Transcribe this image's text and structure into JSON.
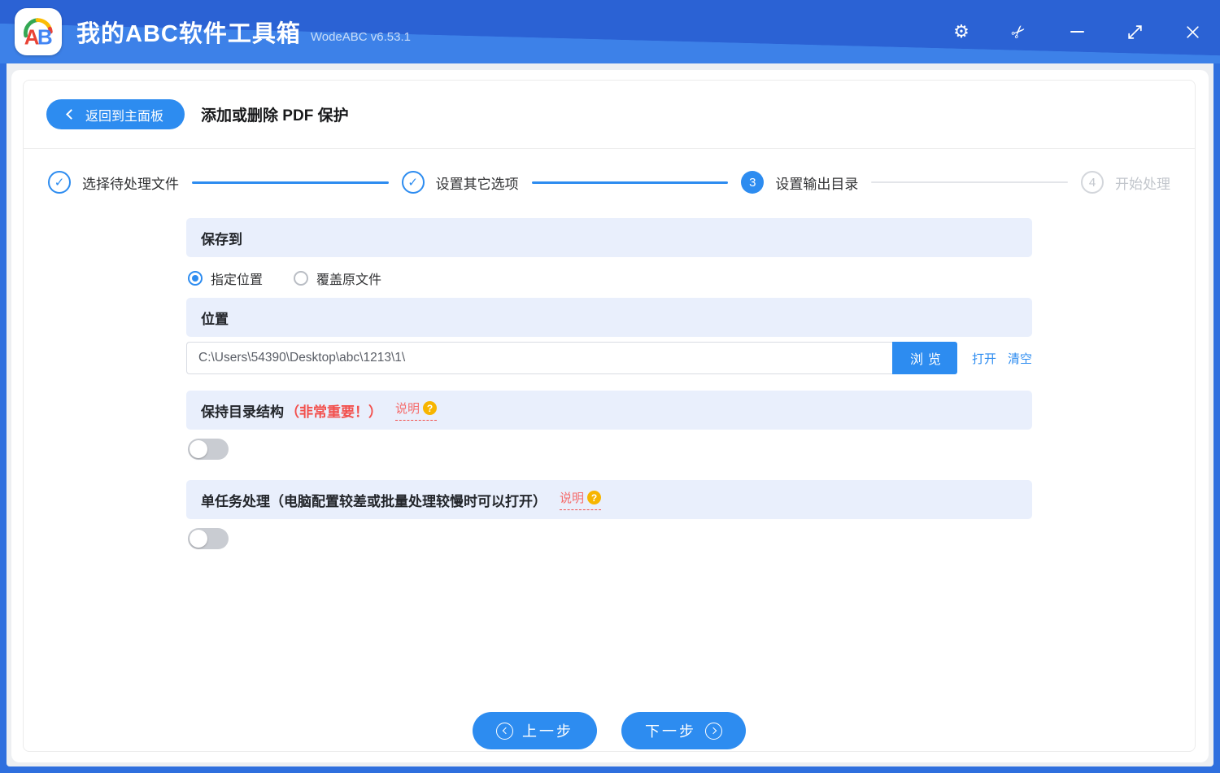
{
  "window": {
    "title": "我的ABC软件工具箱",
    "version": "WodeABC v6.53.1",
    "logo_letters": "AB"
  },
  "titlebar": {
    "icons": [
      "settings-gear",
      "scissors",
      "minimize",
      "maximize",
      "close"
    ],
    "gear_glyph": "⚙",
    "scissors_glyph": "✂"
  },
  "header": {
    "back_label": "返回到主面板",
    "page_title": "添加或删除 PDF 保护"
  },
  "steps": [
    {
      "label": "选择待处理文件",
      "state": "done",
      "glyph": "✓"
    },
    {
      "label": "设置其它选项",
      "state": "done",
      "glyph": "✓"
    },
    {
      "label": "设置输出目录",
      "state": "current",
      "number": "3"
    },
    {
      "label": "开始处理",
      "state": "pending",
      "number": "4"
    }
  ],
  "save_to": {
    "header": "保存到",
    "options": [
      {
        "label": "指定位置",
        "selected": true
      },
      {
        "label": "覆盖原文件",
        "selected": false
      }
    ]
  },
  "location": {
    "header": "位置",
    "path": "C:\\Users\\54390\\Desktop\\abc\\1213\\1\\",
    "browse_label": "浏览",
    "open_label": "打开",
    "clear_label": "清空"
  },
  "keep_structure": {
    "title": "保持目录结构",
    "important_note": "（非常重要！）",
    "help_label": "说明",
    "help_mark": "?",
    "enabled": false
  },
  "single_task": {
    "title": "单任务处理（电脑配置较差或批量处理较慢时可以打开）",
    "help_label": "说明",
    "help_mark": "?",
    "enabled": false
  },
  "footer": {
    "prev_label": "上一步",
    "next_label": "下一步"
  },
  "colors": {
    "titlebar_dark": "#2b62d4",
    "titlebar_light": "#3d81e8",
    "accent_blue": "#2d8cf0",
    "section_bg": "#e9effc",
    "alert_red": "#f2504d",
    "help_orange": "#f7b500",
    "step_inactive": "#c2c6cc"
  }
}
